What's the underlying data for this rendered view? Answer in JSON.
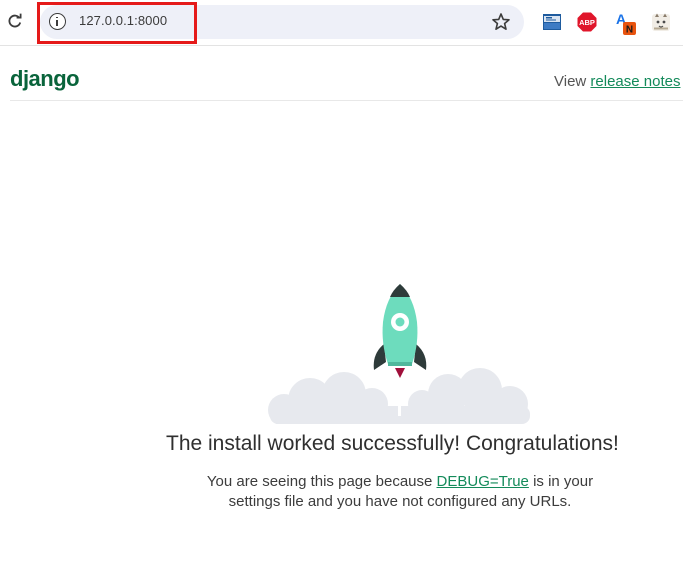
{
  "browser": {
    "url": "127.0.0.1:8000",
    "icons": {
      "reload": "reload-icon",
      "site_info": "info-icon",
      "bookmark": "star-icon"
    },
    "extensions": [
      {
        "name": "screen-capture-extension-icon",
        "label": ""
      },
      {
        "name": "adblock-plus-extension-icon",
        "label": "ABP"
      },
      {
        "name": "translate-extension-icon",
        "label": "A",
        "badge": "N"
      },
      {
        "name": "animal-extension-icon",
        "label": ""
      }
    ]
  },
  "django": {
    "logo": "django",
    "release_prefix": "View ",
    "release_link": "release notes",
    "headline": "The install worked successfully! Congratulations!",
    "subtext": {
      "before": "You are seeing this page because ",
      "link": "DEBUG=True",
      "after": " is in your settings file and you have not configured any URLs."
    }
  },
  "colors": {
    "brand": "#09643b",
    "link": "#138a5a",
    "rocket": "#6ddcbd",
    "highlight": "#e51a1a"
  }
}
